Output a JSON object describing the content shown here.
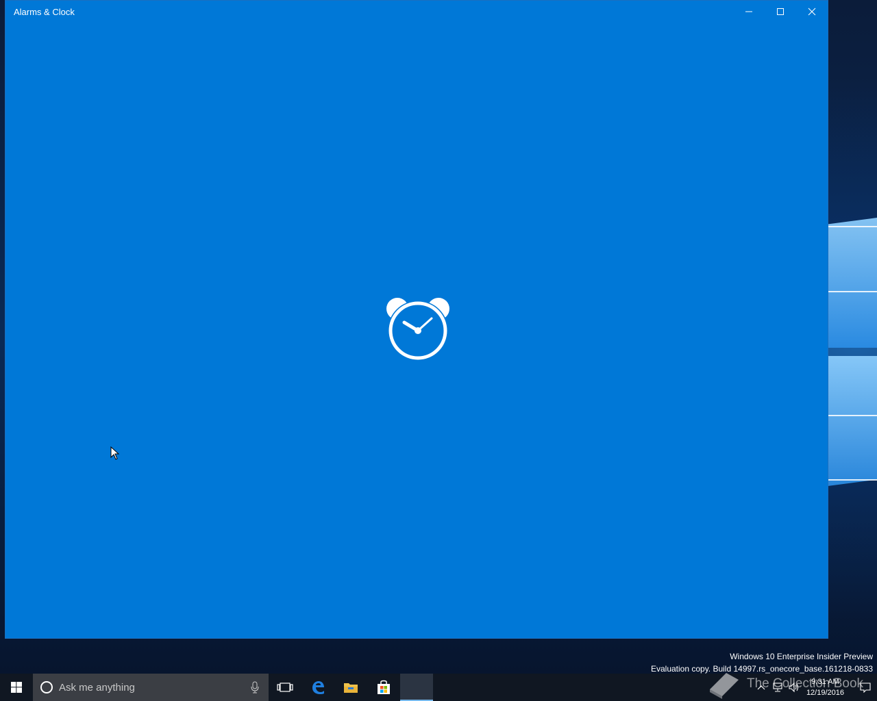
{
  "window": {
    "title": "Alarms & Clock",
    "background": "#0078d7",
    "controls": {
      "minimize_icon": "minimize-icon",
      "maximize_icon": "maximize-icon",
      "close_icon": "close-icon"
    }
  },
  "splash": {
    "icon": "alarm-clock-icon"
  },
  "watermark": {
    "line1": "Windows 10 Enterprise Insider Preview",
    "line2": "Evaluation copy. Build 14997.rs_onecore_base.161218-0833"
  },
  "taskbar": {
    "start_icon": "windows-logo-icon",
    "search": {
      "placeholder": "Ask me anything",
      "cortana_icon": "cortana-icon",
      "mic_icon": "microphone-icon"
    },
    "pinned": [
      {
        "name": "task-view",
        "icon": "task-view-icon"
      },
      {
        "name": "edge",
        "icon": "edge-icon"
      },
      {
        "name": "file-explorer",
        "icon": "folder-icon"
      },
      {
        "name": "store",
        "icon": "store-icon"
      },
      {
        "name": "alarms-clock",
        "icon": "alarm-clock-icon",
        "active": true
      }
    ],
    "tray": {
      "time": "9:31 AM",
      "date": "12/19/2016",
      "icons": [
        "chevron-up-icon",
        "network-icon",
        "volume-icon",
        "action-center-icon"
      ]
    }
  },
  "overlay_mark": "The Collection Book"
}
